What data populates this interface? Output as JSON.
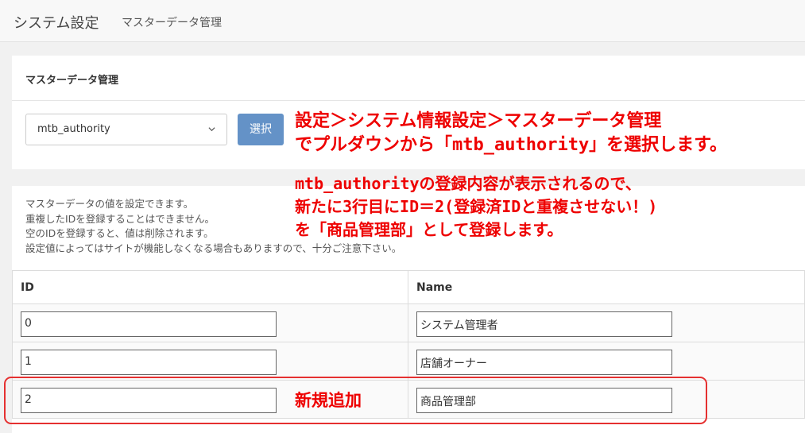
{
  "header": {
    "title": "システム設定",
    "subtitle": "マスターデータ管理"
  },
  "master_card": {
    "heading": "マスターデータ管理",
    "select_value": "mtb_authority",
    "select_button": "選択"
  },
  "annotations": {
    "step1_line1": "設定＞システム情報設定＞マスターデータ管理",
    "step1_line2": "でプルダウンから「mtb_authority」を選択します。",
    "step2_line1": "mtb_authorityの登録内容が表示されるので、",
    "step2_line2": "新たに3行目にID＝2(登録済IDと重複させない！)",
    "step2_line3": "を「商品管理部」として登録します。",
    "new_row": "新規追加"
  },
  "notes": [
    "マスターデータの値を設定できます。",
    "重複したIDを登録することはできません。",
    "空のIDを登録すると、値は削除されます。",
    "設定値によってはサイトが機能しなくなる場合もありますので、十分ご注意下さい。"
  ],
  "table": {
    "columns": [
      "ID",
      "Name"
    ],
    "rows": [
      {
        "id": "0",
        "name": "システム管理者"
      },
      {
        "id": "1",
        "name": "店舗オーナー"
      },
      {
        "id": "2",
        "name": "商品管理部"
      }
    ]
  },
  "colors": {
    "accent_button": "#6492c7",
    "annotation_red": "#ee0000"
  }
}
